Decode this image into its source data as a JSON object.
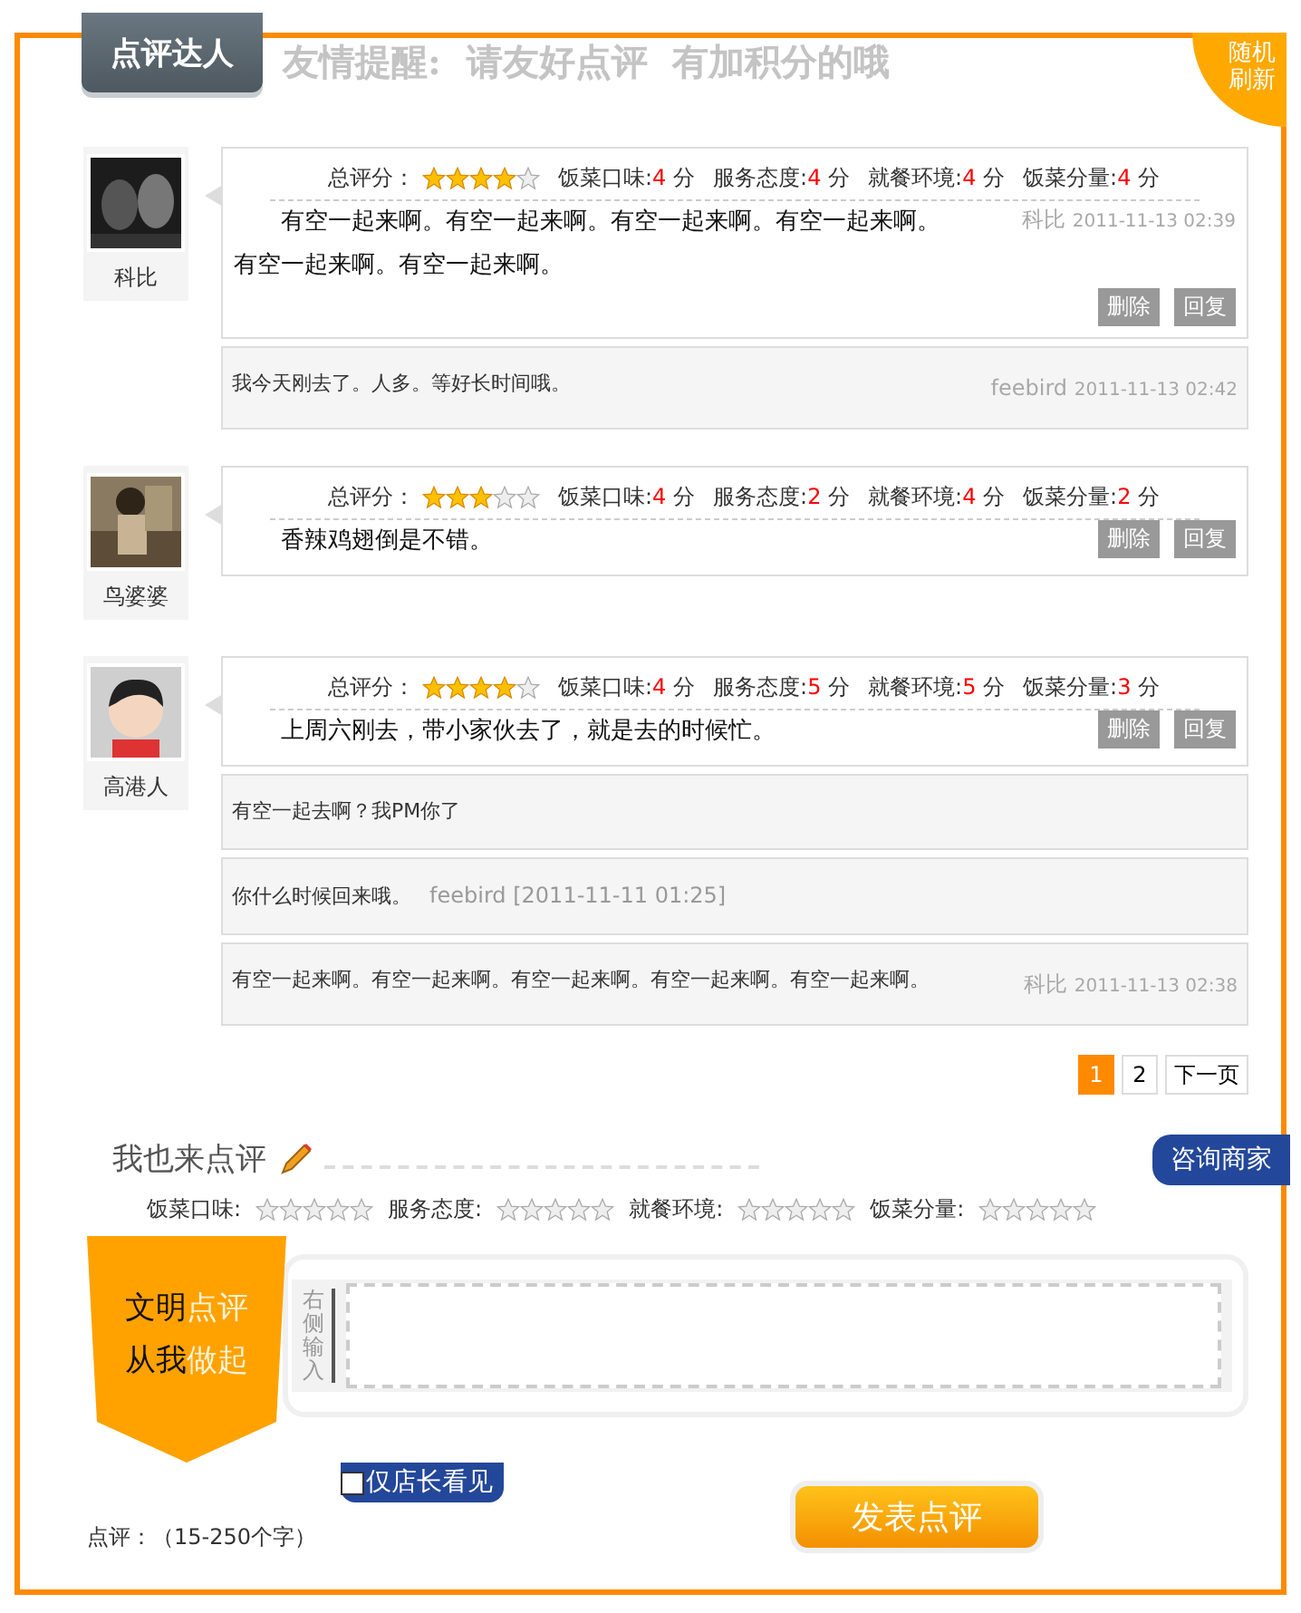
{
  "header": {
    "tab": "点评达人",
    "reminder": "友情提醒:  请友好点评  有加积分的哦",
    "refresh_badge": "随机刷新"
  },
  "reviews": [
    {
      "user": "科比",
      "avatar": {
        "kind": "dark"
      },
      "overall_label": "总评分：",
      "stars": 4,
      "scores": [
        {
          "label": "饭菜口味:",
          "value": "4",
          "unit": "分"
        },
        {
          "label": "服务态度:",
          "value": "4",
          "unit": "分"
        },
        {
          "label": "就餐环境:",
          "value": "4",
          "unit": "分"
        },
        {
          "label": "饭菜分量:",
          "value": "4",
          "unit": "分"
        }
      ],
      "text": "有空一起来啊。有空一起来啊。有空一起来啊。有空一起来啊。有空一起来啊。有空一起来啊。",
      "author": "科比",
      "time": "2011-11-13 02:39",
      "actions": [
        "删除",
        "回复"
      ],
      "replies": [
        {
          "kind": "meta_right",
          "text": "我今天刚去了。人多。等好长时间哦。",
          "author": "feebird",
          "time": "2011-11-13 02:42"
        }
      ]
    },
    {
      "user": "鸟婆婆",
      "avatar": {
        "kind": "sepia"
      },
      "overall_label": "总评分：",
      "stars": 3,
      "scores": [
        {
          "label": "饭菜口味:",
          "value": "4",
          "unit": "分"
        },
        {
          "label": "服务态度:",
          "value": "2",
          "unit": "分"
        },
        {
          "label": "就餐环境:",
          "value": "4",
          "unit": "分"
        },
        {
          "label": "饭菜分量:",
          "value": "2",
          "unit": "分"
        }
      ],
      "text": "香辣鸡翅倒是不错。",
      "actions": [
        "删除",
        "回复"
      ]
    },
    {
      "user": "高港人",
      "avatar": {
        "kind": "cartoon"
      },
      "overall_label": "总评分：",
      "stars": 4,
      "scores": [
        {
          "label": "饭菜口味:",
          "value": "4",
          "unit": "分"
        },
        {
          "label": "服务态度:",
          "value": "5",
          "unit": "分"
        },
        {
          "label": "就餐环境:",
          "value": "5",
          "unit": "分"
        },
        {
          "label": "饭菜分量:",
          "value": "3",
          "unit": "分"
        }
      ],
      "text": "上周六刚去，带小家伙去了，就是去的时候忙。",
      "actions": [
        "删除",
        "回复"
      ],
      "replies": [
        {
          "kind": "plain",
          "text": "有空一起去啊？我PM你了"
        },
        {
          "kind": "inline",
          "text": "你什么时候回来哦。",
          "author": "feebird",
          "time": "[2011-11-11 01:25]"
        },
        {
          "kind": "meta_right",
          "text": "有空一起来啊。有空一起来啊。有空一起来啊。有空一起来啊。有空一起来啊。",
          "author": "科比",
          "time": "2011-11-13 02:38"
        }
      ]
    }
  ],
  "pagination": {
    "pages": [
      {
        "label": "1",
        "selected": true
      },
      {
        "label": "2",
        "selected": false
      }
    ],
    "next": "下一页"
  },
  "form": {
    "title": "我也来点评",
    "ratings": [
      {
        "label": "饭菜口味:",
        "stars": 0
      },
      {
        "label": "服务态度:",
        "stars": 0
      },
      {
        "label": "就餐环境:",
        "stars": 0
      },
      {
        "label": "饭菜分量:",
        "stars": 0
      }
    ],
    "slogan": [
      {
        "strong": "文明",
        "light": "点评"
      },
      {
        "strong": "从我",
        "light": "做起"
      }
    ],
    "side_hint": "右侧输入",
    "private": {
      "label": "仅店长看见",
      "checked": false
    },
    "length_hint": "点评：（15-250个字）",
    "submit": "发表点评"
  },
  "consult": "咨询商家"
}
